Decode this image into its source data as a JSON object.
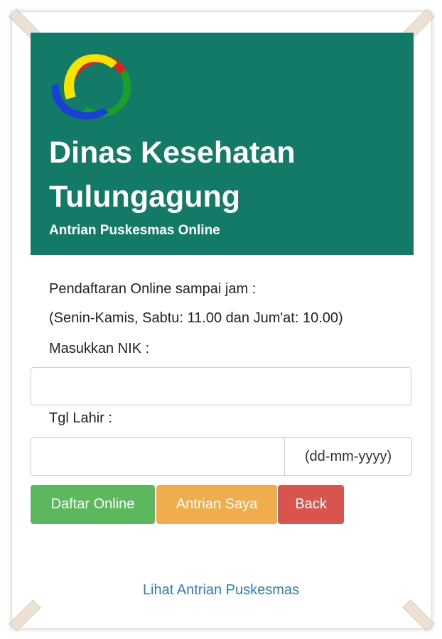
{
  "header": {
    "title": "Dinas Kesehatan Tulungagung",
    "subtitle": "Antrian Puskesmas Online",
    "background": "#137a68",
    "logo_icon": "swirl-logo-icon"
  },
  "info": {
    "line1": "Pendaftaran Online sampai jam :",
    "line2": "(Senin-Kamis, Sabtu: 11.00 dan Jum'at: 10.00)"
  },
  "form": {
    "nik_label": "Masukkan NIK :",
    "nik_value": "",
    "dob_label": "Tgl Lahir :",
    "dob_value": "",
    "dob_format": "(dd-mm-yyyy)"
  },
  "buttons": {
    "daftar": "Daftar Online",
    "antrian": "Antrian Saya",
    "back": "Back"
  },
  "colors": {
    "success": "#5cb85c",
    "warning": "#f0ad4e",
    "danger": "#d9534f",
    "link": "#337ab7"
  },
  "link": {
    "text": "Lihat Antrian Puskesmas"
  }
}
